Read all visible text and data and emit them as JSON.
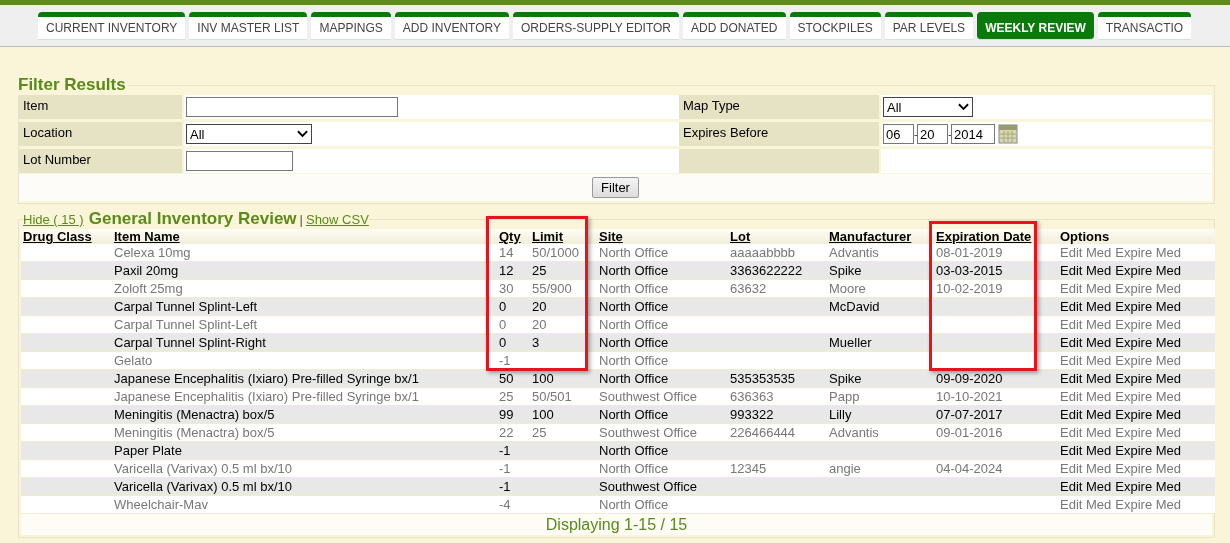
{
  "tabs": [
    {
      "label": "CURRENT INVENTORY",
      "selected": false
    },
    {
      "label": "INV MASTER LIST",
      "selected": false
    },
    {
      "label": "MAPPINGS",
      "selected": false
    },
    {
      "label": "ADD INVENTORY",
      "selected": false
    },
    {
      "label": "ORDERS-SUPPLY EDITOR",
      "selected": false
    },
    {
      "label": "ADD DONATED",
      "selected": false
    },
    {
      "label": "STOCKPILES",
      "selected": false
    },
    {
      "label": "PAR LEVELS",
      "selected": false
    },
    {
      "label": "WEEKLY REVIEW",
      "selected": true
    },
    {
      "label": "TRANSACTIO",
      "selected": false
    }
  ],
  "filter": {
    "title": "Filter Results",
    "left_fields": [
      {
        "label": "Item",
        "kind": "text"
      },
      {
        "label": "Location",
        "kind": "select",
        "value": "All"
      },
      {
        "label": "Lot Number",
        "kind": "short"
      }
    ],
    "right_fields": [
      {
        "label": "Map Type",
        "kind": "select",
        "value": "All"
      },
      {
        "label": "Expires Before",
        "kind": "date",
        "month": "06",
        "day": "20",
        "year": "2014",
        "separator": "-"
      }
    ],
    "button": "Filter"
  },
  "review": {
    "hide_link": "Hide ( 15 )",
    "title": "General Inventory Review",
    "separator": "|",
    "csv_link": "Show CSV",
    "columns": [
      {
        "label": "Drug Class",
        "sortable": true
      },
      {
        "label": "Item Name",
        "sortable": true
      },
      {
        "label": "Qty",
        "sortable": true
      },
      {
        "label": "Limit",
        "sortable": true
      },
      {
        "label": "Site",
        "sortable": true
      },
      {
        "label": "Lot",
        "sortable": true
      },
      {
        "label": "Manufacturer",
        "sortable": true
      },
      {
        "label": "Expiration Date",
        "sortable": true
      },
      {
        "label": "Options",
        "sortable": false
      }
    ],
    "rows": [
      {
        "item": "Celexa 10mg",
        "qty": "14",
        "limit": "50/1000",
        "site": "North Office",
        "lot": "aaaaabbbb",
        "manufacturer": "Advantis",
        "expiration": "08-01-2019",
        "options": [
          "Edit Med",
          "Expire Med"
        ]
      },
      {
        "item": "Paxil 20mg",
        "qty": "12",
        "limit": "25",
        "site": "North Office",
        "lot": "3363622222",
        "manufacturer": "Spike",
        "expiration": "03-03-2015",
        "options": [
          "Edit Med",
          "Expire Med"
        ]
      },
      {
        "item": "Zoloft 25mg",
        "qty": "30",
        "limit": "55/900",
        "site": "North Office",
        "lot": "63632",
        "manufacturer": "Moore",
        "expiration": "10-02-2019",
        "options": [
          "Edit Med",
          "Expire Med"
        ]
      },
      {
        "item": "Carpal Tunnel Splint-Left",
        "qty": "0",
        "limit": "20",
        "site": "North Office",
        "manufacturer": "McDavid",
        "options": [
          "Edit Med",
          "Expire Med"
        ]
      },
      {
        "item": "Carpal Tunnel Splint-Left",
        "qty": "0",
        "limit": "20",
        "site": "North Office",
        "options": [
          "Edit Med",
          "Expire Med"
        ]
      },
      {
        "item": "Carpal Tunnel Splint-Right",
        "qty": "0",
        "limit": "3",
        "site": "North Office",
        "manufacturer": "Mueller",
        "options": [
          "Edit Med",
          "Expire Med"
        ]
      },
      {
        "item": "Gelato",
        "qty": "-1",
        "site": "North Office",
        "options": [
          "Edit Med",
          "Expire Med"
        ]
      },
      {
        "item": "Japanese Encephalitis (Ixiaro) Pre-filled Syringe bx/1",
        "qty": "50",
        "limit": "100",
        "site": "North Office",
        "lot": "535353535",
        "manufacturer": "Spike",
        "expiration": "09-09-2020",
        "options": [
          "Edit Med",
          "Expire Med"
        ]
      },
      {
        "item": "Japanese Encephalitis (Ixiaro) Pre-filled Syringe bx/1",
        "qty": "25",
        "limit": "50/501",
        "site": "Southwest Office",
        "lot": "636363",
        "manufacturer": "Papp",
        "expiration": "10-10-2021",
        "options": [
          "Edit Med",
          "Expire Med"
        ]
      },
      {
        "item": "Meningitis (Menactra) box/5",
        "qty": "99",
        "limit": "100",
        "site": "North Office",
        "lot": "993322",
        "manufacturer": "Lilly",
        "expiration": "07-07-2017",
        "options": [
          "Edit Med",
          "Expire Med"
        ]
      },
      {
        "item": "Meningitis (Menactra) box/5",
        "qty": "22",
        "limit": "25",
        "site": "Southwest Office",
        "lot": "226466444",
        "manufacturer": "Advantis",
        "expiration": "09-01-2016",
        "options": [
          "Edit Med",
          "Expire Med"
        ]
      },
      {
        "item": "Paper Plate",
        "qty": "-1",
        "site": "North Office",
        "options": [
          "Edit Med",
          "Expire Med"
        ]
      },
      {
        "item": "Varicella (Varivax) 0.5 ml bx/10",
        "qty": "-1",
        "site": "North Office",
        "lot": "12345",
        "manufacturer": "angie",
        "expiration": "04-04-2024",
        "options": [
          "Edit Med",
          "Expire Med"
        ]
      },
      {
        "item": "Varicella (Varivax) 0.5 ml bx/10",
        "qty": "-1",
        "site": "Southwest Office",
        "options": [
          "Edit Med",
          "Expire Med"
        ]
      },
      {
        "item": "Wheelchair-Mav",
        "qty": "-4",
        "site": "North Office",
        "options": [
          "Edit Med",
          "Expire Med"
        ]
      }
    ],
    "footer": "Displaying 1-15 / 15"
  }
}
